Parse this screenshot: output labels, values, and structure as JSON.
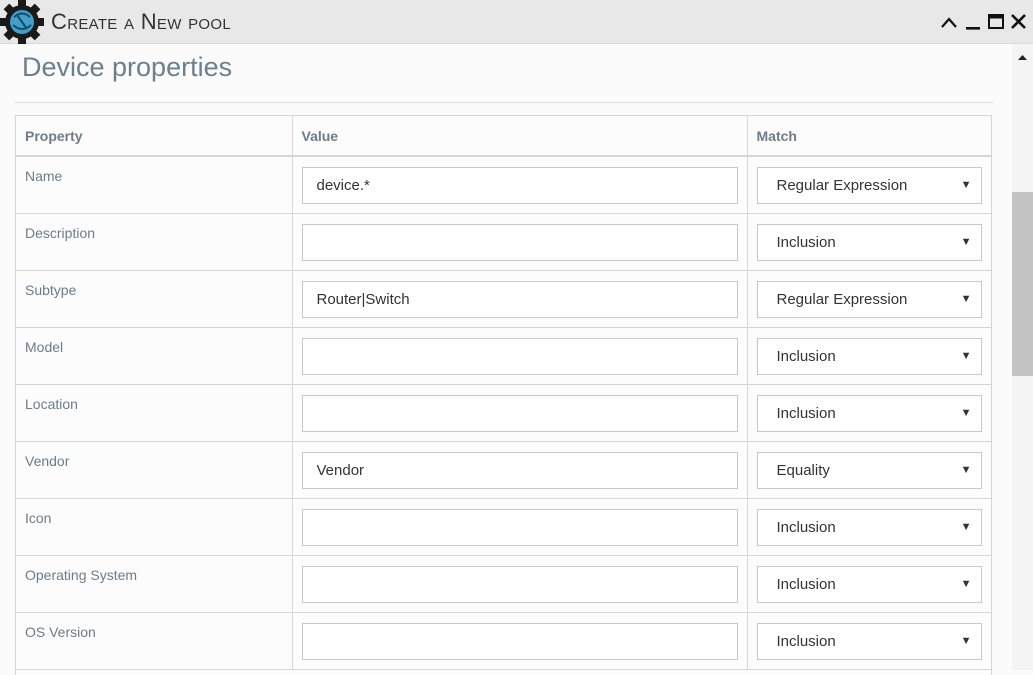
{
  "window": {
    "title": "Create a New pool",
    "controls": [
      "collapse-icon",
      "minimize-icon",
      "maximize-icon",
      "close-icon"
    ]
  },
  "section": {
    "title": "Device properties"
  },
  "table": {
    "headers": {
      "property": "Property",
      "value": "Value",
      "match": "Match"
    },
    "rows": [
      {
        "property": "Name",
        "value": "device.*",
        "match": "Regular Expression"
      },
      {
        "property": "Description",
        "value": "",
        "match": "Inclusion"
      },
      {
        "property": "Subtype",
        "value": "Router|Switch",
        "match": "Regular Expression"
      },
      {
        "property": "Model",
        "value": "",
        "match": "Inclusion"
      },
      {
        "property": "Location",
        "value": "",
        "match": "Inclusion"
      },
      {
        "property": "Vendor",
        "value": "Vendor",
        "match": "Equality"
      },
      {
        "property": "Icon",
        "value": "",
        "match": "Inclusion"
      },
      {
        "property": "Operating System",
        "value": "",
        "match": "Inclusion"
      },
      {
        "property": "OS Version",
        "value": "",
        "match": "Inclusion"
      }
    ],
    "select_caret": "▼"
  },
  "colors": {
    "title_bar": "#e8e8e8",
    "heading": "#6b7f91",
    "label": "#6d7c8b",
    "border": "#d6d6d6"
  }
}
